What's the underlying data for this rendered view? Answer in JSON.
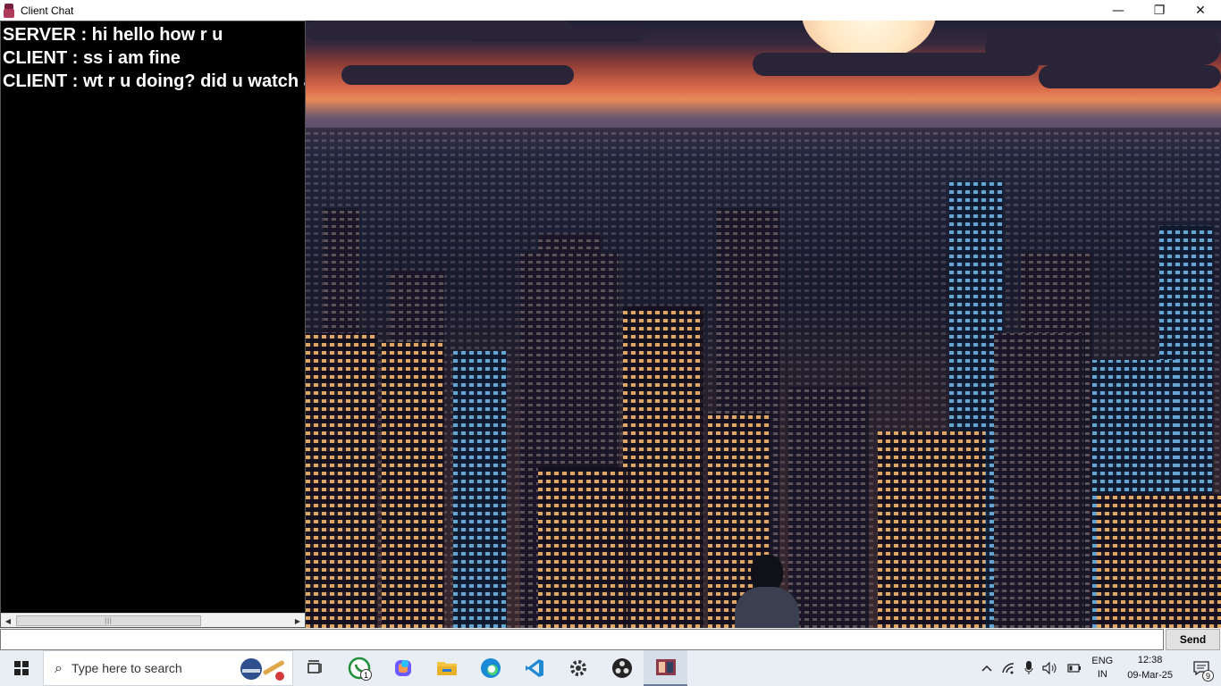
{
  "window": {
    "title": "Client Chat",
    "minimize": "—",
    "restore": "❐",
    "close": "✕"
  },
  "chat": {
    "messages": [
      "SERVER : hi hello how r u",
      "CLIENT : ss i am fine",
      "CLIENT : wt r u doing? did u watch a"
    ]
  },
  "input": {
    "value": "",
    "placeholder": ""
  },
  "send_label": "Send",
  "taskbar": {
    "search_placeholder": "Type here to search",
    "pinned": [
      {
        "name": "task-view",
        "icon": "task-view-icon"
      },
      {
        "name": "whatsapp",
        "icon": "whatsapp-icon",
        "badge": "1"
      },
      {
        "name": "copilot",
        "icon": "copilot-icon"
      },
      {
        "name": "file-explorer",
        "icon": "folder-icon"
      },
      {
        "name": "edge",
        "icon": "edge-icon"
      },
      {
        "name": "vscode",
        "icon": "vscode-icon"
      },
      {
        "name": "settings",
        "icon": "gear-icon"
      },
      {
        "name": "obs",
        "icon": "obs-icon"
      },
      {
        "name": "client-chat",
        "icon": "java-app-icon"
      }
    ],
    "tray": {
      "lang_line1": "ENG",
      "lang_line2": "IN",
      "time": "12:38",
      "date": "09-Mar-25",
      "notification_count": "9"
    }
  },
  "colors": {
    "chat_bg": "#000000",
    "chat_text": "#ffffff",
    "taskbar_bg": "#e9eef5"
  }
}
